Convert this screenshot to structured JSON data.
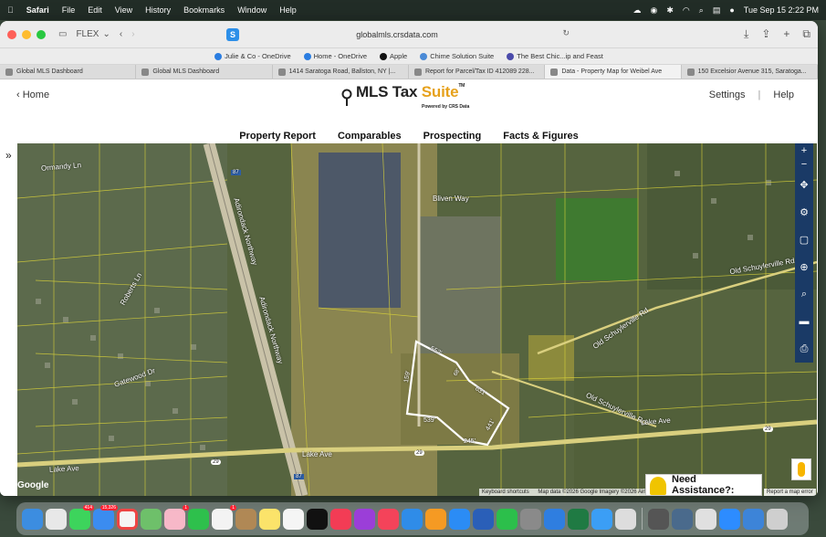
{
  "menubar": {
    "apple": "",
    "items": [
      "Safari",
      "File",
      "Edit",
      "View",
      "History",
      "Bookmarks",
      "Window",
      "Help"
    ],
    "datetime": "Tue Sep 15  2:22 PM"
  },
  "browser": {
    "profile_label": "FLEX",
    "url": "globalmls.crsdata.com",
    "favorites": [
      "Julie & Co - OneDrive",
      "Home - OneDrive",
      "Apple",
      "Chime Solution Suite",
      "The Best Chic...ip and Feast"
    ],
    "tabs": [
      {
        "label": "Global MLS Dashboard"
      },
      {
        "label": "Global MLS Dashboard"
      },
      {
        "label": "1414 Saratoga Road, Ballston, NY |..."
      },
      {
        "label": "Report for Parcel/Tax ID 412089 228..."
      },
      {
        "label": "Data - Property Map for Weibel Ave"
      },
      {
        "label": "150 Excelsior Avenue 315, Saratoga..."
      }
    ]
  },
  "app": {
    "home_label": "Home",
    "logo_main": "MLS Tax ",
    "logo_suite": "Suite",
    "logo_tm": "TM",
    "logo_sub": "Powered by CRS Data",
    "settings_label": "Settings",
    "separator": "|",
    "help_label": "Help",
    "nav": [
      "Property Report",
      "Comparables",
      "Prospecting",
      "Facts & Figures"
    ]
  },
  "map": {
    "road_labels": {
      "ormandy": "Ormandy Ln",
      "adirondack1": "Adirondack Northway",
      "adirondack2": "Adirondack Northway",
      "bliven": "Bliven Way",
      "roberts": "Roberts Ln",
      "gatewood": "Gatewood Dr",
      "old_schuyler1": "Old Schuylerville Rd",
      "old_schuyler2": "Old Schuylerville Rd",
      "old_schuyler3": "Old Schuylerville Rd",
      "lake_ave1": "Lake Ave",
      "lake_ave2": "Lake Ave",
      "lake_ave3": "Lake Ave",
      "route_87a": "87",
      "route_87b": "87",
      "route_29a": "29",
      "route_29b": "29",
      "route_29c": "29"
    },
    "parcel_dims": [
      "552'",
      "159'",
      "68'",
      "631'",
      "539'",
      "441'",
      "245'"
    ],
    "assist_label": "Need Assistance?:",
    "attribution": [
      "Keyboard shortcuts",
      "Map data ©2026 Google Imagery ©2026 Airbus"
    ],
    "report_error": "Report a map error",
    "google": "Google",
    "tools": [
      "zoom-in",
      "zoom-out",
      "compass",
      "settings",
      "draw",
      "locate",
      "search",
      "measure",
      "print"
    ]
  },
  "dock": {
    "badges": {
      "messages": "414",
      "mail": "15,326",
      "photos": "1",
      "reminders": "1"
    }
  },
  "colors": {
    "toolbar_bg": "#ececec",
    "tool_strip": "#1a3a66",
    "parcel_line": "#d9d23a",
    "selected_parcel": "#ffffff",
    "suite_orange": "#e6a11c"
  }
}
